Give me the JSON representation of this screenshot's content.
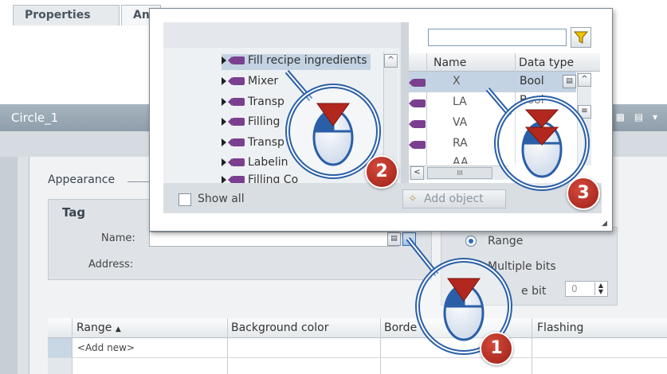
{
  "window": {
    "title": "Circle_1"
  },
  "tabs": [
    {
      "label": "Properties"
    },
    {
      "label": "An"
    }
  ],
  "appearance": {
    "section_title": "Appearance",
    "tag_group_title": "Tag",
    "name_label": "Name:",
    "name_value": "",
    "address_label": "Address:",
    "range_option": "Range",
    "multiple_bits_option": "Multiple bits",
    "single_bit_option": "e bit",
    "bit_value": "0"
  },
  "grid": {
    "columns": [
      "Range",
      "Background color",
      "Borde",
      "Flashing"
    ],
    "sort_indicator": "▲",
    "add_new": "<Add new>"
  },
  "popup": {
    "tree_items": [
      {
        "label": "Fill recipe ingredients",
        "selected": true
      },
      {
        "label": "Mixer"
      },
      {
        "label": "Transp"
      },
      {
        "label": "Filling"
      },
      {
        "label": "Transp"
      },
      {
        "label": "Labelin"
      },
      {
        "label": "Filling Co"
      }
    ],
    "filter_value": "",
    "table_headers": [
      "Name",
      "Data type"
    ],
    "rows": [
      {
        "name": "X",
        "type": "Bool",
        "selected": true
      },
      {
        "name": "LA",
        "type": "Bool"
      },
      {
        "name": "VA",
        "type": ""
      },
      {
        "name": "RA",
        "type": ""
      },
      {
        "name": "AA",
        "type": ""
      }
    ],
    "show_all_label": "Show all",
    "add_object_label": "Add object",
    "hscroll_thumb": "III"
  },
  "callouts": [
    {
      "number": "1"
    },
    {
      "number": "2"
    },
    {
      "number": "3"
    }
  ],
  "colors": {
    "titlebar": "#95a4b0",
    "selection": "#c4d3e3",
    "callout_ring": "#2a5fa8",
    "callout_badge": "#b2281e"
  }
}
